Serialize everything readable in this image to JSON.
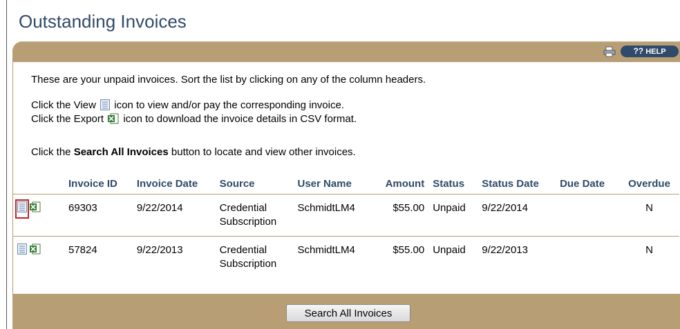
{
  "page": {
    "title": "Outstanding Invoices"
  },
  "toolbar": {
    "print_icon": "print-icon",
    "help_q": "??",
    "help_label": "HELP"
  },
  "instructions": {
    "line1": "These are your unpaid invoices. Sort the list by clicking on any of the column headers.",
    "view_before": "Click the View",
    "view_after": "icon to view and/or pay the corresponding invoice.",
    "export_before": "Click the Export",
    "export_after": "icon to download the invoice details in CSV format.",
    "search_before": "Click the",
    "search_bold": "Search All Invoices",
    "search_after": "button to locate and view other invoices."
  },
  "table": {
    "headers": {
      "invoice_id": "Invoice ID",
      "invoice_date": "Invoice Date",
      "source": "Source",
      "user_name": "User Name",
      "amount": "Amount",
      "status": "Status",
      "status_date": "Status Date",
      "due_date": "Due Date",
      "overdue": "Overdue"
    },
    "rows": [
      {
        "invoice_id": "69303",
        "invoice_date": "9/22/2014",
        "source_line1": "Credential",
        "source_line2": "Subscription",
        "user_name": "SchmidtLM4",
        "amount": "$55.00",
        "status": "Unpaid",
        "status_date": "9/22/2014",
        "due_date": "",
        "overdue": "N"
      },
      {
        "invoice_id": "57824",
        "invoice_date": "9/22/2013",
        "source_line1": "Credential",
        "source_line2": "Subscription",
        "user_name": "SchmidtLM4",
        "amount": "$55.00",
        "status": "Unpaid",
        "status_date": "9/22/2013",
        "due_date": "",
        "overdue": "N"
      }
    ]
  },
  "footer": {
    "search_button": "Search All Invoices"
  },
  "colors": {
    "toolbar_tan": "#b79e74",
    "title_blue": "#2f4a6a",
    "selection_red": "#c0232a"
  }
}
